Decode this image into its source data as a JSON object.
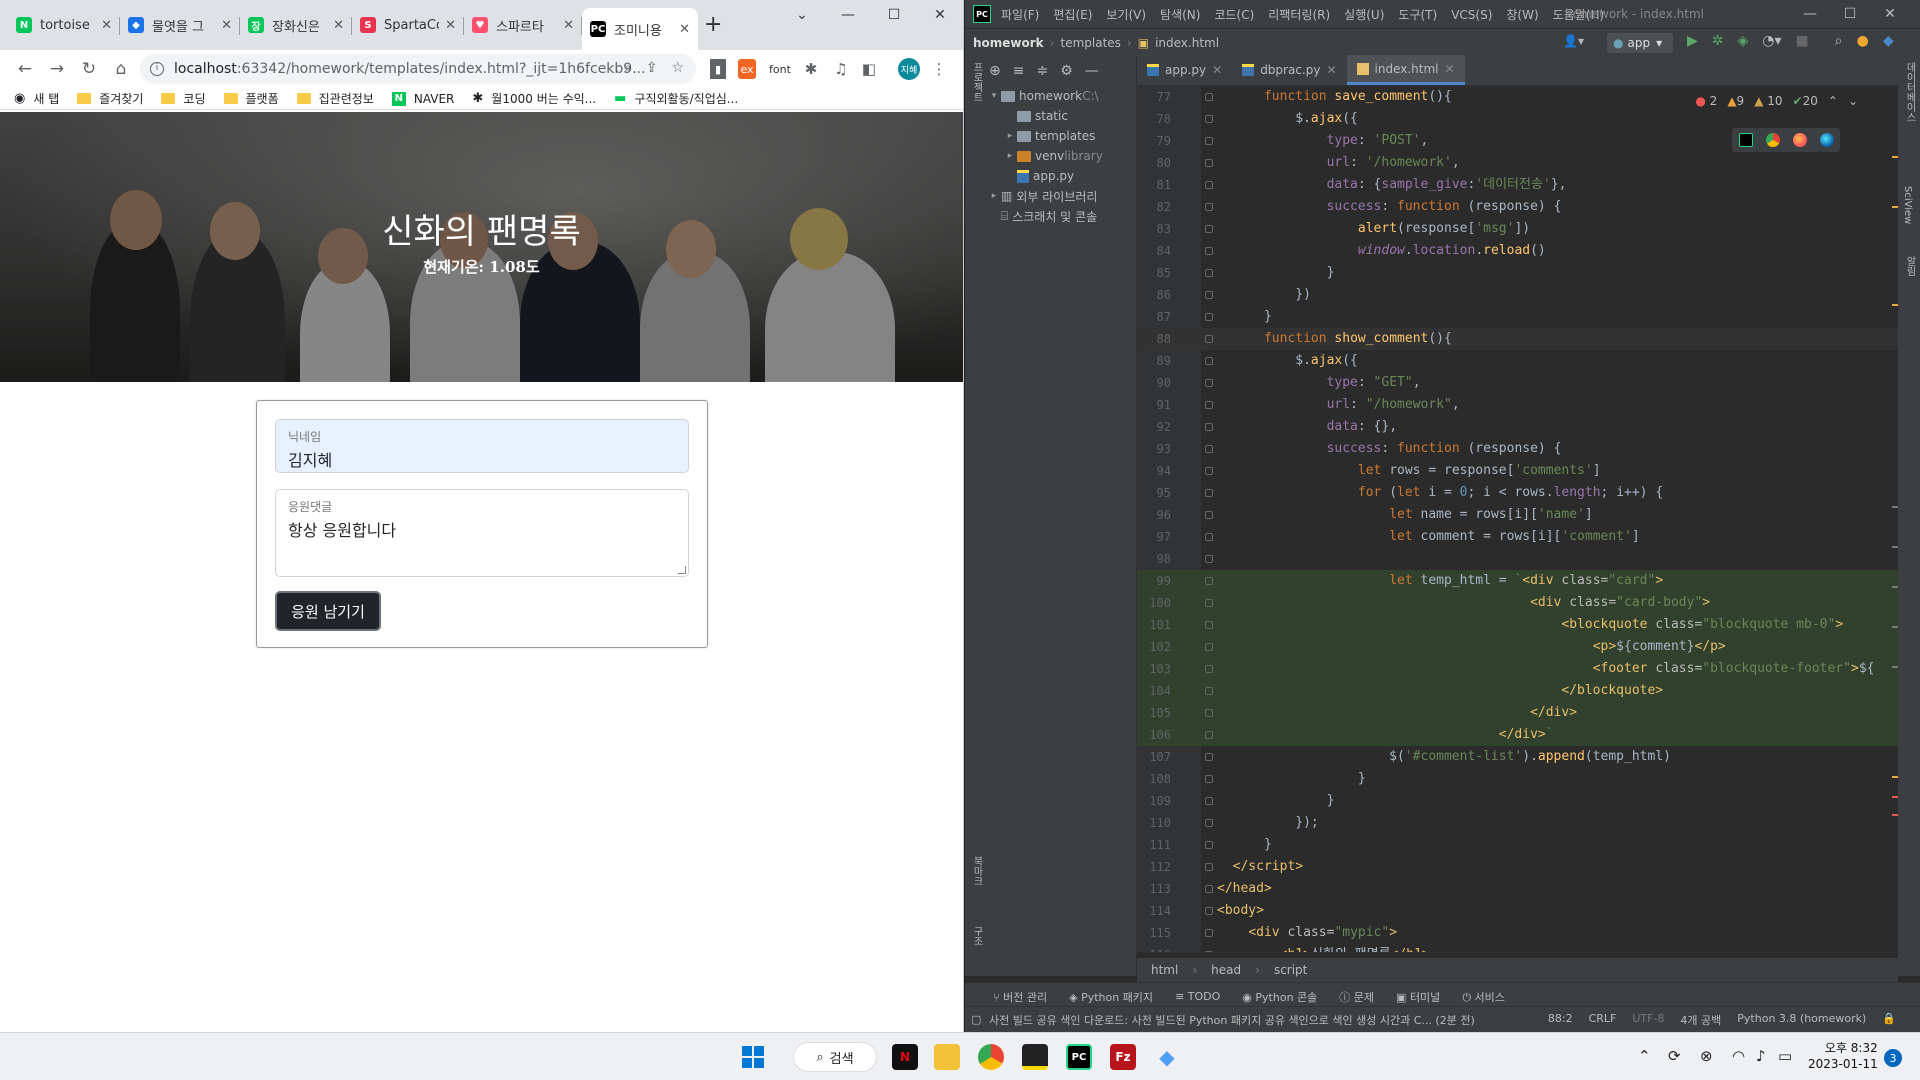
{
  "browser": {
    "tabs": [
      {
        "title": "tortoise",
        "fav_color": "#03c75a",
        "fav_char": "N"
      },
      {
        "title": "물엿을 그",
        "fav_color": "#1a73e8",
        "fav_char": "◆"
      },
      {
        "title": "장화신은",
        "fav_color": "#03c75a",
        "fav_char": "장"
      },
      {
        "title": "SpartaCo",
        "fav_color": "#e8344e",
        "fav_char": "S"
      },
      {
        "title": "스파르타",
        "fav_color": "#ff4f6d",
        "fav_char": "♥"
      },
      {
        "title": "조미니용",
        "fav_color": "#000000",
        "fav_char": "PC"
      }
    ],
    "url_host": "localhost",
    "url_rest": ":63342/homework/templates/index.html?_ijt=1h6fcekb9...",
    "ext_font": "font",
    "profile_label": "지혜",
    "bookmarks": [
      {
        "label": "새 탭",
        "icon": "globe-icon"
      },
      {
        "label": "즐겨찾기",
        "icon": "folder-icon"
      },
      {
        "label": "코딩",
        "icon": "folder-icon"
      },
      {
        "label": "플랫폼",
        "icon": "folder-icon"
      },
      {
        "label": "집관련정보",
        "icon": "folder-icon"
      },
      {
        "label": "NAVER",
        "icon": "naver-icon"
      },
      {
        "label": "월1000 버는 수익...",
        "icon": "slack-icon"
      },
      {
        "label": "구직외활동/직업심...",
        "icon": "chat-icon"
      }
    ]
  },
  "webpage": {
    "title": "신화의 팬명록",
    "temperature": "현재기온: 1.08도",
    "name_label": "닉네임",
    "name_value": "김지혜",
    "comment_label": "응원댓글",
    "comment_value": "항상 응원합니다",
    "submit_label": "응원 남기기"
  },
  "ide": {
    "menu": [
      "파일(F)",
      "편집(E)",
      "보기(V)",
      "탐색(N)",
      "코드(C)",
      "리팩터링(R)",
      "실행(U)",
      "도구(T)",
      "VCS(S)",
      "창(W)",
      "도움말(H)"
    ],
    "window_title": "homework - index.html",
    "breadcrumbs": [
      "homework",
      "templates",
      "index.html"
    ],
    "run_config": "app",
    "project_tree": [
      {
        "label": "homework",
        "suffix": "C:\\",
        "type": "folder",
        "indent": 0,
        "open": true
      },
      {
        "label": "static",
        "type": "folder",
        "indent": 1
      },
      {
        "label": "templates",
        "type": "folder",
        "indent": 1,
        "closed": true
      },
      {
        "label": "venv",
        "suffix": "library",
        "type": "excluded",
        "indent": 1,
        "closed": true
      },
      {
        "label": "app.py",
        "type": "py",
        "indent": 1
      },
      {
        "label": "외부 라이브러리",
        "type": "lib",
        "indent": 0,
        "closed": true
      },
      {
        "label": "스크래치 및 콘솔",
        "type": "scratch",
        "indent": 0
      }
    ],
    "editor_tabs": [
      "app.py",
      "dbprac.py",
      "index.html"
    ],
    "inspections": {
      "errors": "2",
      "warnings": "9",
      "weak": "10",
      "ok": "20"
    },
    "code_breadcrumb": [
      "html",
      "head",
      "script"
    ],
    "tool_windows": [
      "버전 관리",
      "Python 패키지",
      "TODO",
      "Python 콘솔",
      "문제",
      "터미널",
      "서비스"
    ],
    "status_msg": "사전 빌드 공유 색인 다운로드: 사전 빌드된 Python 패키지 공유 색인으로 색인 생성 시간과 C... (2분 전)",
    "status_right": [
      "88:2",
      "CRLF",
      "UTF-8",
      "4개 공백",
      "Python 3.8 (homework)"
    ],
    "side_labels": {
      "project": "프로젝트",
      "bookmarks": "북마크",
      "structure": "구조",
      "database": "데이터베이스",
      "sciview": "SciView",
      "notifications": "알림"
    }
  },
  "taskbar": {
    "search_label": "검색",
    "clock_time": "오후 8:32",
    "clock_date": "2023-01-11",
    "notif_count": "3"
  }
}
